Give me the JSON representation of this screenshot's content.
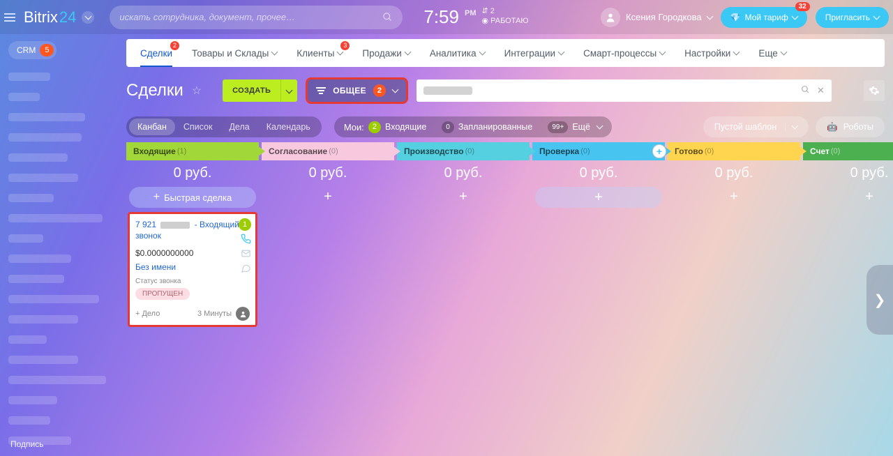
{
  "header": {
    "logo_main": "Bitrix",
    "logo_sub": "24",
    "search_placeholder": "искать сотрудника, документ, прочее…",
    "time": "7:59",
    "ampm": "PM",
    "meta1": "2",
    "meta2": "РАБОТАЮ",
    "username": "Ксения Городкова",
    "tariff_label": "Мой тариф",
    "tariff_badge": "32",
    "invite_label": "Пригласить"
  },
  "crm": {
    "label": "CRM",
    "badge": "5"
  },
  "tabs": [
    {
      "label": "Сделки",
      "badge": "2",
      "active": true,
      "dropdown": false
    },
    {
      "label": "Товары и Склады",
      "dropdown": true
    },
    {
      "label": "Клиенты",
      "badge": "3",
      "dropdown": true
    },
    {
      "label": "Продажи",
      "dropdown": true
    },
    {
      "label": "Аналитика",
      "dropdown": true
    },
    {
      "label": "Интеграции",
      "dropdown": true
    },
    {
      "label": "Смарт-процессы",
      "dropdown": true
    },
    {
      "label": "Настройки",
      "dropdown": true
    },
    {
      "label": "Еще",
      "dropdown": true
    }
  ],
  "title_row": {
    "page_title": "Сделки",
    "create_label": "СОЗДАТЬ",
    "filter_label": "ОБЩЕЕ",
    "filter_badge": "2"
  },
  "views": {
    "items": [
      "Канбан",
      "Список",
      "Дела",
      "Календарь"
    ],
    "my_label": "Мои:",
    "incoming_badge": "2",
    "incoming_label": "Входящие",
    "planned_badge": "0",
    "planned_label": "Запланированные",
    "more_badge": "99+",
    "more_label": "Ещё",
    "template_btn": "Пустой шаблон",
    "robots_btn": "Роботы"
  },
  "columns": [
    {
      "name": "Входящие",
      "count": "(1)",
      "sum": "0 руб."
    },
    {
      "name": "Согласование",
      "count": "(0)",
      "sum": "0 руб."
    },
    {
      "name": "Производство",
      "count": "(0)",
      "sum": "0 руб."
    },
    {
      "name": "Проверка",
      "count": "(0)",
      "sum": "0 руб."
    },
    {
      "name": "Готово",
      "count": "(0)",
      "sum": "0 руб."
    },
    {
      "name": "Счет",
      "count": "(0)",
      "sum": "0 руб."
    }
  ],
  "quick_add": "Быстрая сделка",
  "card": {
    "title_pre": "7 921",
    "title_post": "- Входящий звонок",
    "chip": "1",
    "amount": "$0.0000000000",
    "contact": "Без имени",
    "status_label": "Статус звонка",
    "status_tag": "ПРОПУЩЕН",
    "plus_deal": "+ Дело",
    "time": "3 Минуты"
  },
  "bottom_sign": "Подпись"
}
